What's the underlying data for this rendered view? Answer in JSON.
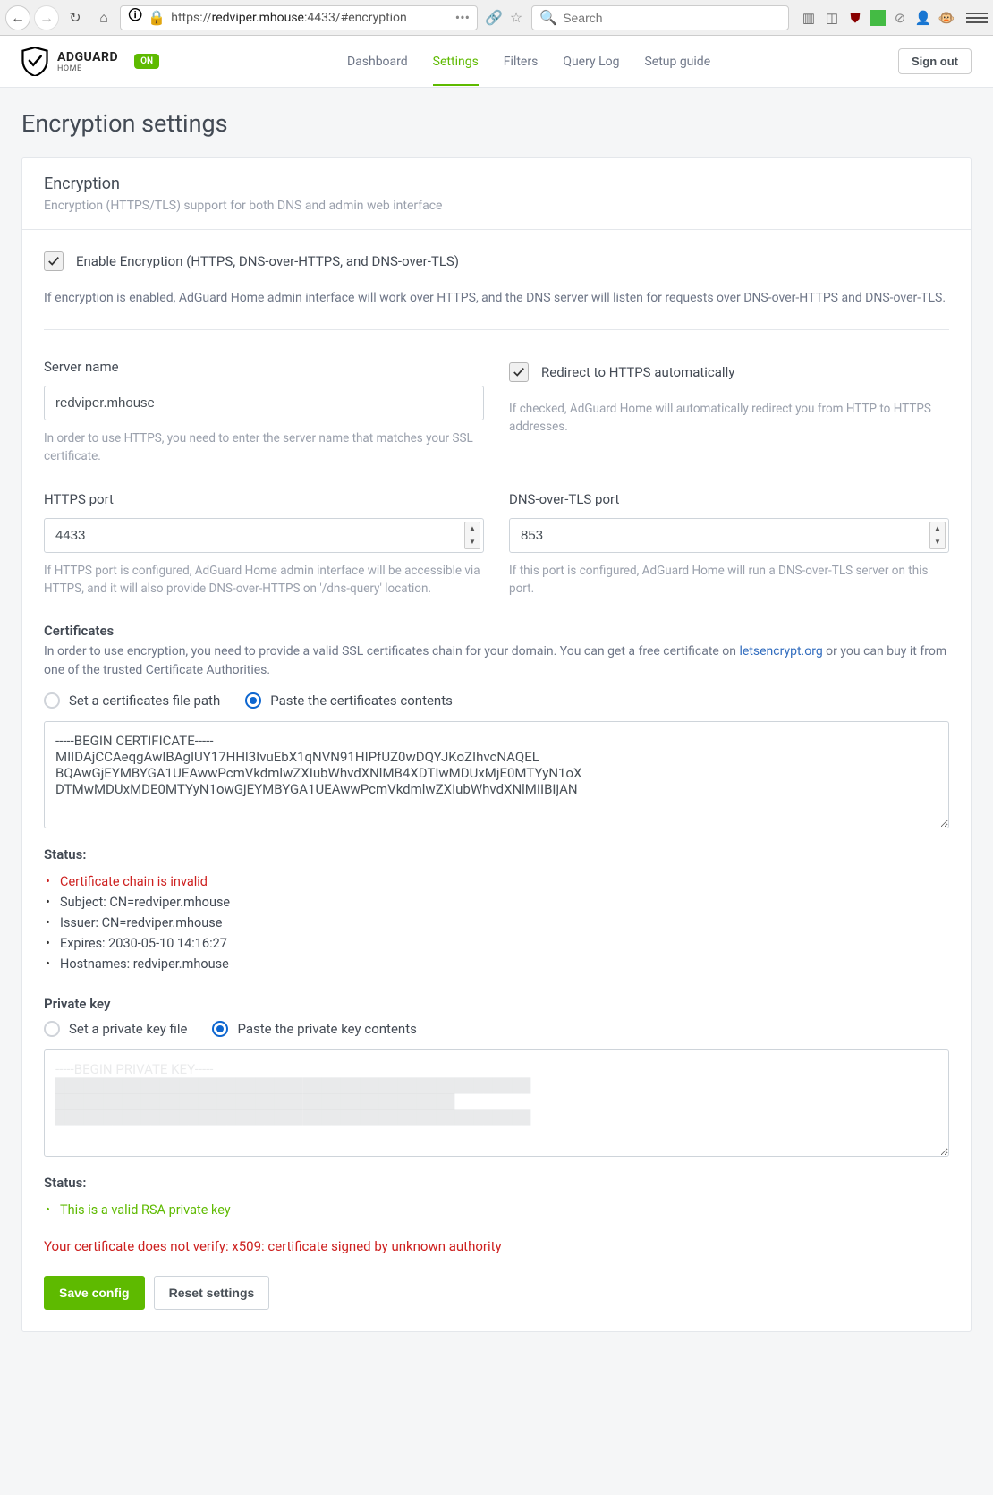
{
  "browser": {
    "url_prefix": "https://",
    "url_host": "redviper.mhouse",
    "url_rest": ":4433/#encryption",
    "search_placeholder": "Search"
  },
  "header": {
    "brand": "ADGUARD",
    "sub": "HOME",
    "badge": "ON",
    "nav": {
      "dashboard": "Dashboard",
      "settings": "Settings",
      "filters": "Filters",
      "querylog": "Query Log",
      "setupguide": "Setup guide"
    },
    "signout": "Sign out"
  },
  "page": {
    "title": "Encryption settings"
  },
  "card": {
    "title": "Encryption",
    "subtitle": "Encryption (HTTPS/TLS) support for both DNS and admin web interface"
  },
  "enable": {
    "label": "Enable Encryption (HTTPS, DNS-over-HTTPS, and DNS-over-TLS)",
    "help": "If encryption is enabled, AdGuard Home admin interface will work over HTTPS, and the DNS server will listen for requests over DNS-over-HTTPS and DNS-over-TLS."
  },
  "server": {
    "label": "Server name",
    "value": "redviper.mhouse",
    "help": "In order to use HTTPS, you need to enter the server name that matches your SSL certificate."
  },
  "redirect": {
    "label": "Redirect to HTTPS automatically",
    "help": "If checked, AdGuard Home will automatically redirect you from HTTP to HTTPS addresses."
  },
  "https_port": {
    "label": "HTTPS port",
    "value": "4433",
    "help": "If HTTPS port is configured, AdGuard Home admin interface will be accessible via HTTPS, and it will also provide DNS-over-HTTPS on '/dns-query' location."
  },
  "dot_port": {
    "label": "DNS-over-TLS port",
    "value": "853",
    "help": "If this port is configured, AdGuard Home will run a DNS-over-TLS server on this port."
  },
  "certs": {
    "label": "Certificates",
    "desc_a": "In order to use encryption, you need to provide a valid SSL certificates chain for your domain. You can get a free certificate on ",
    "link": "letsencrypt.org",
    "desc_b": " or you can buy it from one of the trusted Certificate Authorities.",
    "radio_path": "Set a certificates file path",
    "radio_paste": "Paste the certificates contents",
    "value": "-----BEGIN CERTIFICATE-----\nMIIDAjCCAeqgAwIBAgIUY17HHl3IvuEbX1qNVN91HIPfUZ0wDQYJKoZIhvcNAQEL\nBQAwGjEYMBYGA1UEAwwPcmVkdmlwZXIubWhvdXNlMB4XDTIwMDUxMjE0MTYyN1oX\nDTMwMDUxMDE0MTYyN1owGjEYMBYGA1UEAwwPcmVkdmlwZXIubWhvdXNlMIIBIjAN",
    "status_label": "Status:",
    "status": {
      "invalid": "Certificate chain is invalid",
      "subject": "Subject: CN=redviper.mhouse",
      "issuer": "Issuer: CN=redviper.mhouse",
      "expires": "Expires: 2030-05-10 14:16:27",
      "hostnames": "Hostnames: redviper.mhouse"
    }
  },
  "pkey": {
    "label": "Private key",
    "radio_path": "Set a private key file",
    "radio_paste": "Paste the private key contents",
    "value": "-----BEGIN PRIVATE KEY-----\n██████████████████████████████████████████████████\n██████████████████████████████████████████\n██████████████████████████████████████████████████",
    "status_label": "Status:",
    "status_ok": "This is a valid RSA private key"
  },
  "verify_error": "Your certificate does not verify: x509: certificate signed by unknown authority",
  "actions": {
    "save": "Save config",
    "reset": "Reset settings"
  }
}
